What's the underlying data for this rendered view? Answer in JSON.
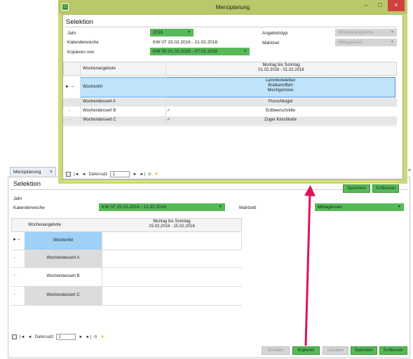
{
  "background": {
    "tab": {
      "label": "Menüplanung",
      "close": "×"
    },
    "edge_close": "×",
    "selection_title": "Selektion",
    "fields": {
      "jahr_label": "Jahr",
      "kw_label": "Kalenderwoche",
      "kw_value": "KW 07   15.02.2016   -   21.02.2016",
      "mahlzeit_label": "Mahlzeit",
      "mahlzeit_value": "Mittagessen"
    },
    "grid": {
      "col1_header": "Wochenangebote",
      "col2_header_line1": "Montag bis Sonntag",
      "col2_header_line2": "15.02.2016 - 15.02.2016",
      "rows": [
        {
          "label": "Wochenhit"
        },
        {
          "label": "Wochendessert A"
        },
        {
          "label": "Wochendessert B"
        },
        {
          "label": "Wochendessert C"
        }
      ]
    },
    "statusbar": {
      "nav_first": "|◄",
      "nav_prev": "◄",
      "record_label": "Datensatz",
      "record_value": "1",
      "nav_next": "►",
      "nav_last": "►|"
    },
    "buttons": {
      "drucken": "Drucken",
      "kopieren": "Kopieren",
      "loeschen": "Löschen",
      "speichern": "Speichern",
      "schliessen": "Schliessen"
    }
  },
  "dialog": {
    "title": "Menüplanung",
    "win_min": "–",
    "win_max": "□",
    "win_close": "×",
    "selection_title": "Selektion",
    "fields": {
      "jahr_label": "Jahr",
      "jahr_value": "2016",
      "kw_label": "Kalenderwoche",
      "kw_value": "KW 07   15.02.2016   -   21.02.2016",
      "kopieren_label": "Kopieren von",
      "kopieren_value": "KW 05   01.02.2016   -   07.02.2016",
      "angebotstyp_label": "Angebotstyp",
      "angebotstyp_value": "Wochenangebote",
      "mahlzeit_label": "Mahlzeit",
      "mahlzeit_value": "Mittagessen"
    },
    "grid": {
      "col1_header": "Wochenangebote",
      "col2_header_line1": "Montag bis Sonntag",
      "col2_header_line2": "01.02.2016 - 01.02.2016",
      "rows": [
        {
          "label": "Wochenhit",
          "check": "",
          "value_lines": [
            "Lammkoteletten",
            "Bratkartoffeln",
            "Mischgemüse"
          ]
        },
        {
          "label": "Wochendessert A",
          "check": "",
          "value_lines": [
            "Punschkugel"
          ]
        },
        {
          "label": "Wochendessert B",
          "check": "✓",
          "value_lines": [
            "Erdbeerschnitte"
          ]
        },
        {
          "label": "Wochendessert C",
          "check": "✓",
          "value_lines": [
            "Zuger Kirschtorte"
          ]
        }
      ]
    },
    "statusbar": {
      "nav_first": "|◄",
      "nav_prev": "◄",
      "record_label": "Datensatz",
      "record_value": "1",
      "nav_next": "►",
      "nav_last": "►|"
    },
    "buttons": {
      "speichern": "Speichern",
      "schliessen": "Schliessen"
    }
  },
  "colors": {
    "accent_green": "#58b958",
    "dialog_frame": "#cdd87e",
    "selected_row": "#9fd0f5",
    "arrow": "#e0125a"
  }
}
